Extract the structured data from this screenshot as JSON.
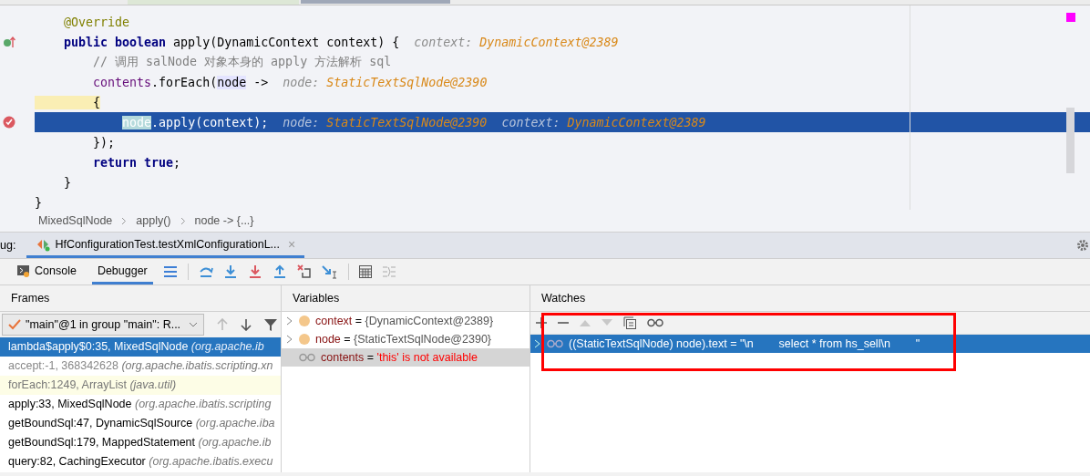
{
  "editor": {
    "lines": [
      {
        "kind": "plain",
        "current": false,
        "tokens": [
          {
            "kind": "annotation",
            "text": "    @Override"
          }
        ]
      },
      {
        "kind": "override",
        "current": false,
        "tokens": [
          {
            "kind": "keyword",
            "text": "    public boolean "
          },
          {
            "kind": "plain",
            "text": "apply(DynamicContext context) {"
          }
        ],
        "hints": [
          {
            "name": "context:",
            "value": "DynamicContext@2389"
          }
        ]
      },
      {
        "kind": "plain",
        "current": false,
        "tokens": [
          {
            "kind": "comment",
            "text": "        // 调用 salNode 对象本身的 apply 方法解析 sql"
          }
        ]
      },
      {
        "kind": "plain",
        "current": false,
        "tokens": [
          {
            "kind": "field",
            "text": "        contents"
          },
          {
            "kind": "plain",
            "text": ".forEach("
          },
          {
            "kind": "ref",
            "text": "node"
          },
          {
            "kind": "plain",
            "text": " ->"
          }
        ],
        "hints": [
          {
            "name": "node:",
            "value": "StaticTextSqlNode@2390"
          }
        ]
      },
      {
        "kind": "plain",
        "current": false,
        "tokens": [
          {
            "kind": "brace",
            "text": "        {"
          }
        ]
      },
      {
        "kind": "breakpoint",
        "current": true,
        "tokens": [
          {
            "kind": "ref",
            "text": "            node"
          },
          {
            "kind": "plain",
            "text": ".apply(context);"
          }
        ],
        "hints": [
          {
            "name": "node:",
            "value": "StaticTextSqlNode@2390"
          },
          {
            "name": "context:",
            "value": "DynamicContext@2389"
          }
        ]
      },
      {
        "kind": "plain",
        "current": false,
        "tokens": [
          {
            "kind": "plain",
            "text": "        });"
          }
        ]
      },
      {
        "kind": "plain",
        "current": false,
        "tokens": [
          {
            "kind": "keyword",
            "text": "        return true"
          },
          {
            "kind": "plain",
            "text": ";"
          }
        ]
      },
      {
        "kind": "plain",
        "current": false,
        "tokens": [
          {
            "kind": "plain",
            "text": "    }"
          }
        ]
      },
      {
        "kind": "plain",
        "current": false,
        "tokens": [
          {
            "kind": "plain",
            "text": "}"
          }
        ]
      }
    ]
  },
  "breadcrumb": [
    "MixedSqlNode",
    "apply()",
    "node -> {...}"
  ],
  "debug_bar": {
    "label": "ug:",
    "tab": "HfConfigurationTest.testXmlConfigurationL...",
    "close": "×"
  },
  "toolbar": {
    "tabs": [
      {
        "label": "Console",
        "selected": false
      },
      {
        "label": "Debugger",
        "selected": true
      }
    ]
  },
  "frames": {
    "title": "Frames",
    "thread": "\"main\"@1 in group \"main\": R...",
    "items": [
      {
        "method": "lambda$apply$0:35, MixedSqlNode",
        "package": "(org.apache.ib",
        "kind": "normal",
        "selected": true
      },
      {
        "method": "accept:-1, 368342628",
        "package": "(org.apache.ibatis.scripting.xn",
        "kind": "library",
        "selected": false
      },
      {
        "method": "forEach:1249, ArrayList",
        "package": "(java.util)",
        "kind": "collection",
        "selected": false
      },
      {
        "method": "apply:33, MixedSqlNode",
        "package": "(org.apache.ibatis.scripting",
        "kind": "normal",
        "selected": false
      },
      {
        "method": "getBoundSql:47, DynamicSqlSource",
        "package": "(org.apache.iba",
        "kind": "normal",
        "selected": false
      },
      {
        "method": "getBoundSql:179, MappedStatement",
        "package": "(org.apache.ib",
        "kind": "normal",
        "selected": false
      },
      {
        "method": "query:82, CachingExecutor",
        "package": "(org.apache.ibatis.execu",
        "kind": "normal",
        "selected": false
      }
    ]
  },
  "variables": {
    "title": "Variables",
    "items": [
      {
        "kind": "field",
        "name": "context",
        "eq": "=",
        "value": "{DynamicContext@2389}",
        "error": false,
        "selected": false
      },
      {
        "kind": "field",
        "name": "node",
        "eq": "=",
        "value": "{StaticTextSqlNode@2390}",
        "error": false,
        "selected": false
      },
      {
        "kind": "watch",
        "name": "contents",
        "eq": "=",
        "value": "'this' is not available",
        "error": true,
        "selected": true
      }
    ]
  },
  "watches": {
    "title": "Watches",
    "items": [
      {
        "expression": "((StaticTextSqlNode) node).text",
        "eq": "=",
        "value": "\"\\n        select * from hs_sell\\n        \"",
        "selected": true
      }
    ]
  }
}
